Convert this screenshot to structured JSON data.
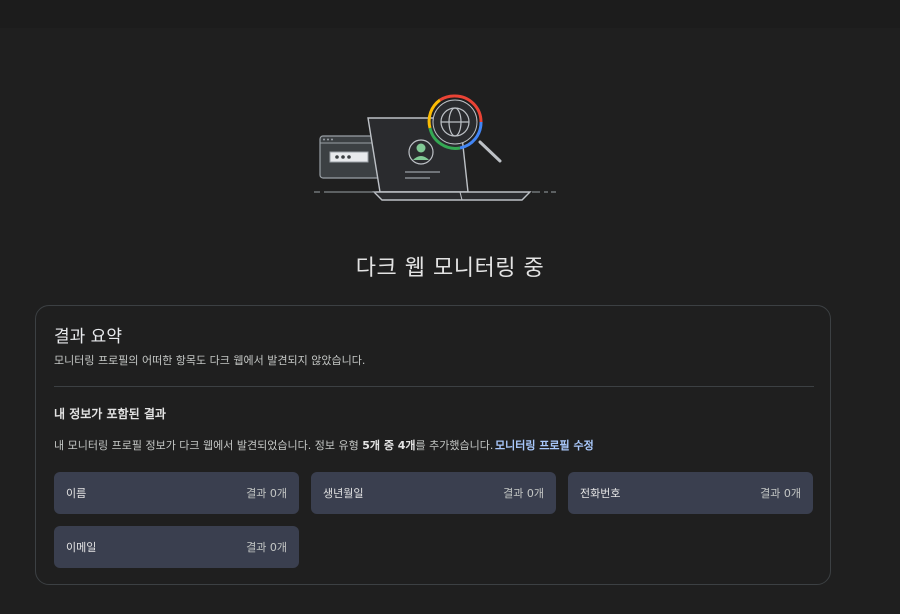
{
  "page": {
    "title": "다크 웹 모니터링 중"
  },
  "summary": {
    "title": "결과 요약",
    "subtitle": "모니터링 프로필의 어떠한 항목도 다크 웹에서 발견되지 않았습니다."
  },
  "found_info": {
    "title": "내 정보가 포함된 결과",
    "desc_prefix": "내 모니터링 프로필 정보가 다크 웹에서 발견되었습니다. 정보 유형 ",
    "desc_bold": "5개 중 4개",
    "desc_suffix": "를 추가했습니다.",
    "edit_link": "모니터링 프로필 수정"
  },
  "tiles": [
    {
      "label": "이름",
      "count": "결과 0개"
    },
    {
      "label": "생년월일",
      "count": "결과 0개"
    },
    {
      "label": "전화번호",
      "count": "결과 0개"
    },
    {
      "label": "이메일",
      "count": "결과 0개"
    }
  ],
  "colors": {
    "background": "#1f1f1f",
    "tile": "#3a3f4f",
    "link": "#a8c7fa",
    "google_blue": "#4285f4",
    "google_red": "#ea4335",
    "google_yellow": "#fbbc04",
    "google_green": "#34a853",
    "avatar_green": "#81c995"
  },
  "icons": {
    "illustration": "dark-web-monitor-illustration",
    "magnifier": "magnifying-glass-icon",
    "globe": "globe-icon",
    "avatar": "person-avatar-icon",
    "password": "password-field-icon"
  }
}
